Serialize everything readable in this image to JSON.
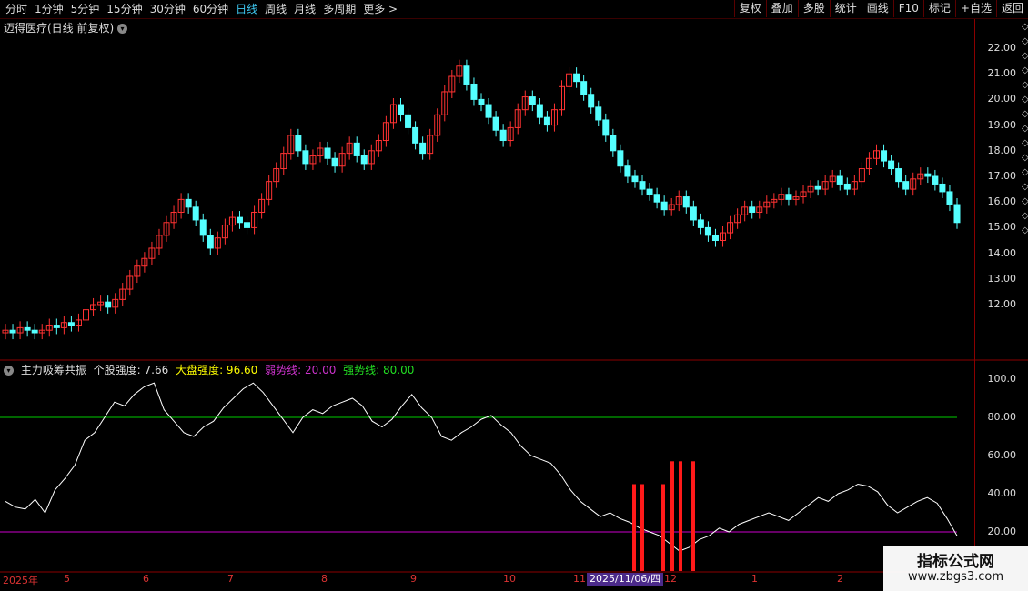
{
  "toolbar": {
    "tabs": [
      "分时",
      "1分钟",
      "5分钟",
      "15分钟",
      "30分钟",
      "60分钟",
      "日线",
      "周线",
      "月线",
      "多周期",
      "更多 >"
    ],
    "active": "日线",
    "tools": [
      "复权",
      "叠加",
      "多股",
      "统计",
      "画线",
      "F10",
      "标记",
      "+自选",
      "返回"
    ]
  },
  "main": {
    "title": "迈得医疗(日线 前复权)",
    "y_ticks": [
      "22.00",
      "21.00",
      "20.00",
      "19.00",
      "18.00",
      "17.00",
      "16.00",
      "15.00",
      "14.00",
      "13.00",
      "12.00"
    ]
  },
  "indicator": {
    "name": "主力吸筹共振",
    "stock_label": "个股强度: 7.66",
    "market_label": "大盘强度: 96.60",
    "weak_label": "弱势线: 20.00",
    "strong_label": "强势线: 80.00",
    "y_ticks": [
      "100.0",
      "80.00",
      "60.00",
      "40.00",
      "20.00"
    ],
    "weak_line": 20,
    "strong_line": 80
  },
  "xaxis": {
    "labels": [
      "2025年",
      "5",
      "6",
      "7",
      "8",
      "9",
      "10",
      "11",
      "12",
      "1",
      "2"
    ],
    "cursor_date": "2025/11/06/四"
  },
  "watermark": {
    "line1": "指标公式网",
    "line2": "www.zbgs3.com"
  },
  "colors": {
    "up": "#ff3232",
    "down": "#54ffff",
    "strong": "#00cc00",
    "weak": "#cc00cc",
    "bar": "#ff1a1a"
  },
  "chart_data": {
    "type": "candlestick",
    "close": [
      11.0,
      10.9,
      11.1,
      11.0,
      10.9,
      11.0,
      11.2,
      11.1,
      11.3,
      11.2,
      11.4,
      11.8,
      12.0,
      12.1,
      11.9,
      12.2,
      12.6,
      13.1,
      13.5,
      13.8,
      14.2,
      14.7,
      15.2,
      15.6,
      16.1,
      15.8,
      15.3,
      14.7,
      14.2,
      14.6,
      15.1,
      15.4,
      15.2,
      15.0,
      15.6,
      16.1,
      16.8,
      17.3,
      17.9,
      18.6,
      18.0,
      17.5,
      17.8,
      18.1,
      17.7,
      17.4,
      17.9,
      18.3,
      17.8,
      17.5,
      18.0,
      18.4,
      19.1,
      19.8,
      19.4,
      18.9,
      18.3,
      17.9,
      18.6,
      19.4,
      20.3,
      20.9,
      21.3,
      20.6,
      20.0,
      19.8,
      19.3,
      18.8,
      18.4,
      18.9,
      19.6,
      20.1,
      19.8,
      19.3,
      19.0,
      19.6,
      20.5,
      21.0,
      20.7,
      20.2,
      19.7,
      19.2,
      18.6,
      18.0,
      17.4,
      17.0,
      16.8,
      16.5,
      16.3,
      16.0,
      15.7,
      15.9,
      16.2,
      15.8,
      15.3,
      15.0,
      14.7,
      14.5,
      14.8,
      15.2,
      15.5,
      15.8,
      15.6,
      15.8,
      16.0,
      16.1,
      16.3,
      16.1,
      16.2,
      16.4,
      16.6,
      16.5,
      16.8,
      17.0,
      16.7,
      16.5,
      16.8,
      17.3,
      17.7,
      18.0,
      17.6,
      17.3,
      16.8,
      16.5,
      16.9,
      17.1,
      17.0,
      16.7,
      16.4,
      15.9,
      15.2
    ],
    "indicator_values": [
      36,
      33,
      32,
      37,
      30,
      42,
      48,
      55,
      68,
      72,
      80,
      88,
      86,
      92,
      96,
      98,
      84,
      78,
      72,
      70,
      75,
      78,
      85,
      90,
      95,
      98,
      93,
      86,
      79,
      72,
      80,
      84,
      82,
      86,
      88,
      90,
      86,
      78,
      75,
      79,
      86,
      92,
      85,
      80,
      70,
      68,
      72,
      75,
      79,
      81,
      76,
      72,
      65,
      60,
      58,
      56,
      50,
      42,
      36,
      32,
      28,
      30,
      27,
      25,
      22,
      20,
      18,
      14,
      10,
      12,
      16,
      18,
      22,
      20,
      24,
      26,
      28,
      30,
      28,
      26,
      30,
      34,
      38,
      36,
      40,
      42,
      45,
      44,
      41,
      34,
      30,
      33,
      36,
      38,
      35,
      27,
      18
    ],
    "signal_bars": [
      {
        "x": "2025/10/28",
        "value": 45
      },
      {
        "x": "2025/10/30",
        "value": 45
      },
      {
        "x": "2025/11/03",
        "value": 45
      },
      {
        "x": "2025/11/05",
        "value": 57
      },
      {
        "x": "2025/11/06",
        "value": 57
      },
      {
        "x": "2025/11/10",
        "value": 57
      }
    ],
    "ylim_price": [
      11.0,
      22.5
    ],
    "ylim_indicator": [
      0,
      100
    ]
  }
}
